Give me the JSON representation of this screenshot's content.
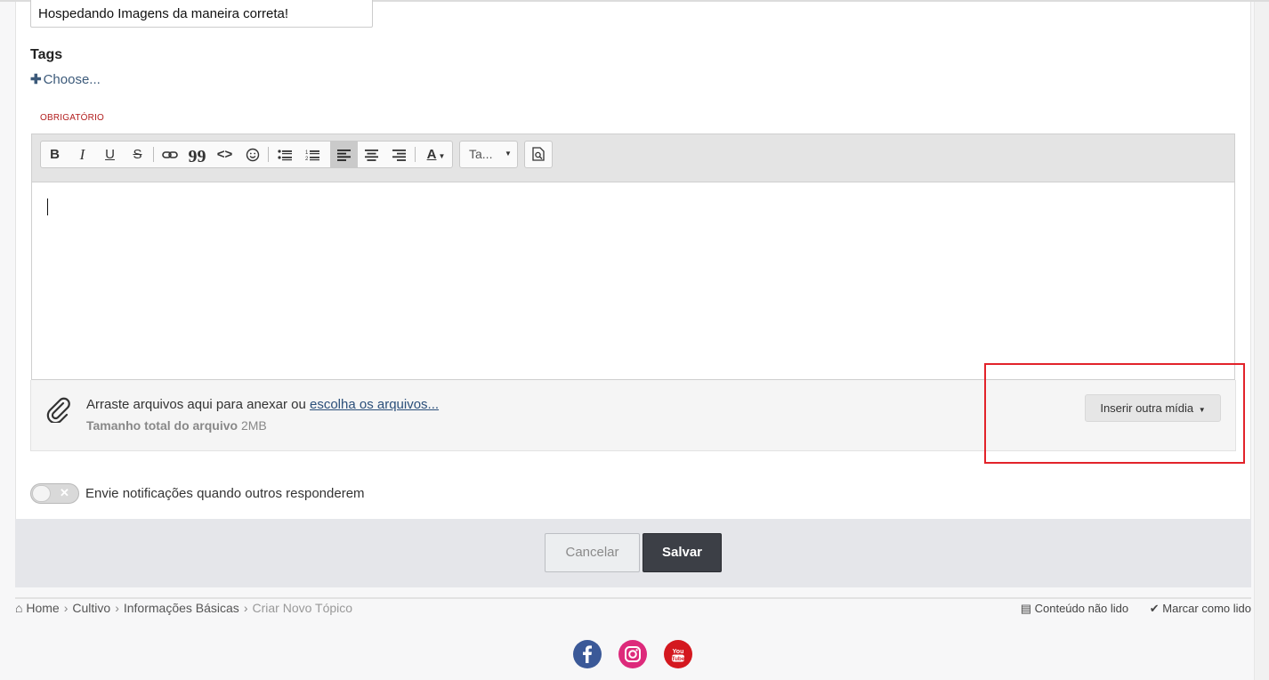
{
  "form": {
    "title_value": "Hospedando Imagens da maneira correta!",
    "tags_label": "Tags",
    "tags_choose": "Choose...",
    "required_label": "OBRIGATÓRIO"
  },
  "toolbar": {
    "buttons": [
      "bold",
      "italic",
      "underline",
      "strikethrough",
      "link",
      "quote",
      "code",
      "emoji",
      "bullet-list",
      "numbered-list",
      "align-left",
      "align-center",
      "align-right",
      "text-color"
    ],
    "active": "align-left",
    "font_dropdown": "Ta...",
    "bold": "B",
    "italic": "I",
    "underline": "U",
    "strike": "S",
    "quote": "99",
    "code": "<>",
    "color": "A"
  },
  "attachments": {
    "drag_text": "Arraste arquivos aqui para anexar ou ",
    "choose_link": "escolha os arquivos...",
    "size_label": "Tamanho total do arquivo",
    "size_value": "2MB",
    "media_button": "Inserir outra mídia"
  },
  "notify": {
    "label": "Envie notificações quando outros responderem",
    "enabled": false
  },
  "actions": {
    "cancel": "Cancelar",
    "save": "Salvar"
  },
  "breadcrumb": {
    "items": [
      "Home",
      "Cultivo",
      "Informações Básicas"
    ],
    "current": "Criar Novo Tópico"
  },
  "footer_links": {
    "unread": "Conteúdo não lido",
    "mark_read": "Marcar como lido"
  },
  "social": {
    "facebook_color": "#3b5998",
    "instagram_color": "#dd2a7b",
    "youtube_color": "#d4181f",
    "youtube_text": "You Tube"
  },
  "colors": {
    "highlight": "#e2232a",
    "save_bg": "#3c3f46",
    "link": "#2b4f7a",
    "required": "#b21d1d"
  }
}
